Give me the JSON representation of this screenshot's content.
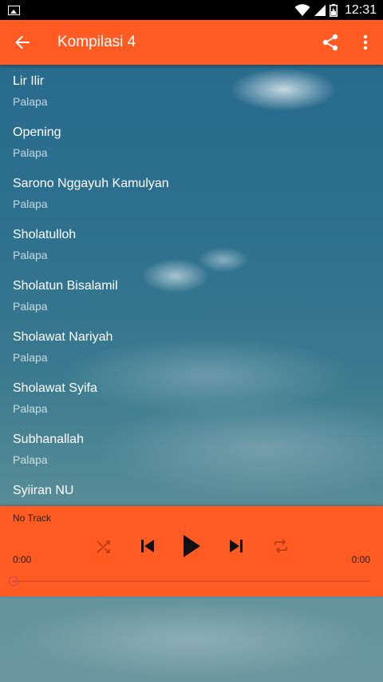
{
  "app": {
    "title": "Kompilasi 4"
  },
  "status": {
    "time": "12:31"
  },
  "tracks": [
    {
      "title": "Lir Ilir",
      "artist": "Palapa"
    },
    {
      "title": "Opening",
      "artist": "Palapa"
    },
    {
      "title": "Sarono Nggayuh Kamulyan",
      "artist": "Palapa"
    },
    {
      "title": "Sholatulloh",
      "artist": "Palapa"
    },
    {
      "title": "Sholatun Bisalamil",
      "artist": "Palapa"
    },
    {
      "title": "Sholawat Nariyah",
      "artist": "Palapa"
    },
    {
      "title": "Sholawat Syifa",
      "artist": "Palapa"
    },
    {
      "title": "Subhanallah",
      "artist": "Palapa"
    },
    {
      "title": "Syiiran NU",
      "artist": ""
    }
  ],
  "player": {
    "now_playing": "No Track",
    "elapsed": "0:00",
    "duration": "0:00",
    "progress": 0
  },
  "colors": {
    "accent": "#ff5b22",
    "seek_thumb": "#c4497a"
  },
  "icons": {
    "back": "arrow-left-icon",
    "share": "share-icon",
    "menu": "more-vert-icon",
    "shuffle": "shuffle-icon",
    "previous": "skip-previous-icon",
    "play": "play-icon",
    "next": "skip-next-icon",
    "repeat": "repeat-icon"
  }
}
